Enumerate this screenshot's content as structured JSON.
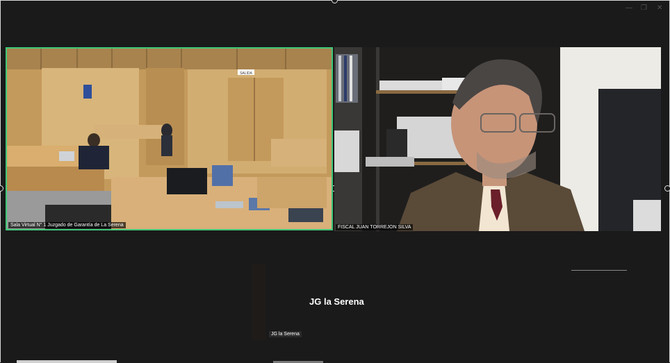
{
  "window": {
    "minimize_icon": "minimize-icon",
    "maximize_icon": "maximize-icon",
    "close_icon": "close-icon"
  },
  "participants": [
    {
      "name": "Sala Virtual N° 1 Juzgado de Garantía de La Serena",
      "video": "courtroom"
    },
    {
      "name": "FISCAL JUAN TORREJON SILVA",
      "video": "office"
    },
    {
      "name": "JG la Serena",
      "display": "JG la Serena",
      "video": "off"
    }
  ],
  "courtroom_sign": "SALIDA",
  "colors": {
    "active_speaker_border": "#40c87a",
    "background": "#1a1a1a"
  }
}
